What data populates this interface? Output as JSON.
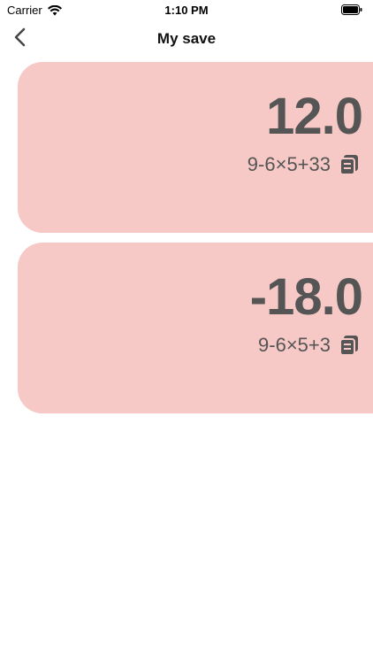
{
  "status_bar": {
    "carrier": "Carrier",
    "time": "1:10 PM",
    "icons": [
      "wifi-icon",
      "battery-icon"
    ]
  },
  "nav": {
    "title": "My save",
    "back_icon": "chevron-left-icon"
  },
  "saved_items": [
    {
      "result": "12.0",
      "expression": "9-6×5+33",
      "icon": "copy-icon"
    },
    {
      "result": "-18.0",
      "expression": "9-6×5+3",
      "icon": "copy-icon"
    }
  ],
  "colors": {
    "card_background": "#f6c9c6",
    "card_text": "#555555"
  }
}
